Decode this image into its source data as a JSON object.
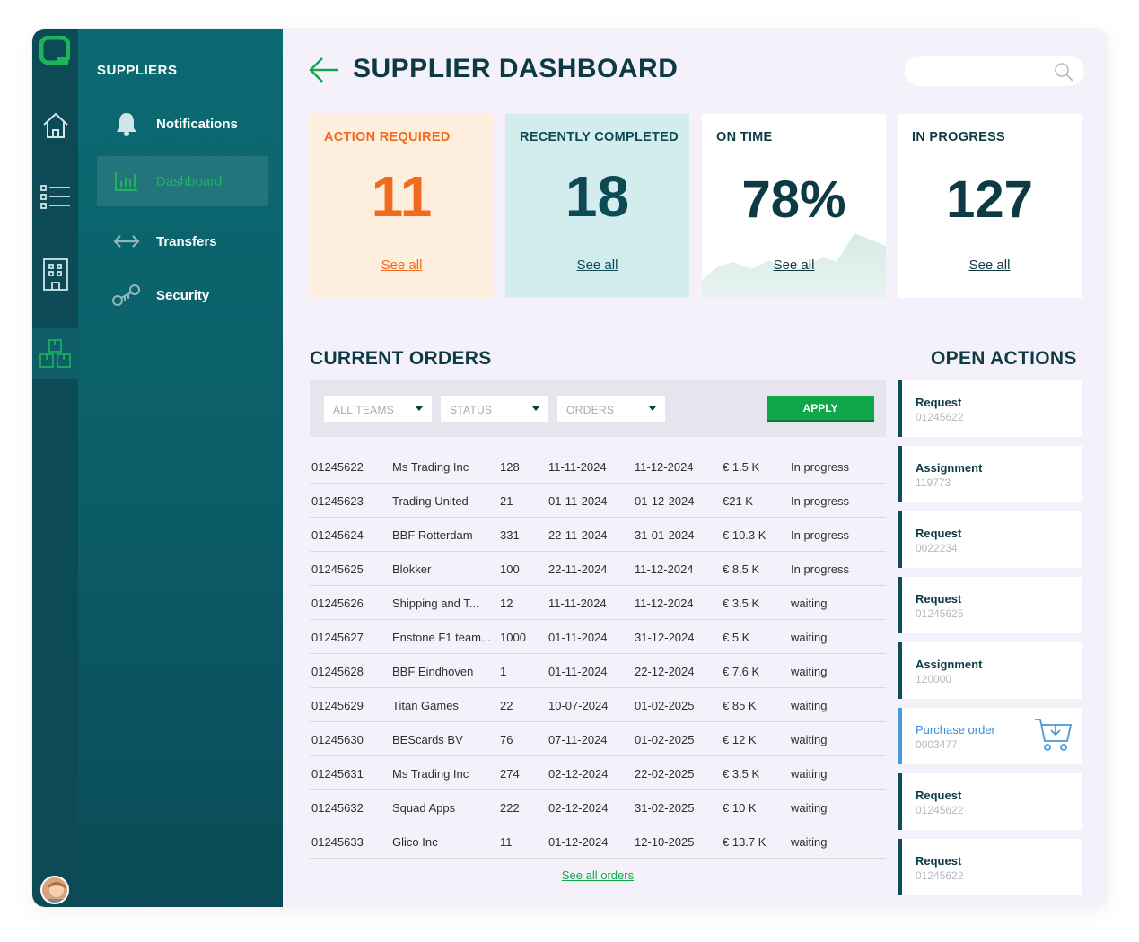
{
  "sidebar": {
    "section_title": "SUPPLIERS",
    "items": [
      {
        "label": "Notifications",
        "icon": "bell-icon"
      },
      {
        "label": "Dashboard",
        "icon": "chart-icon",
        "active": true
      },
      {
        "label": "Transfers",
        "icon": "arrows-icon"
      },
      {
        "label": "Security",
        "icon": "key-icon"
      }
    ]
  },
  "header": {
    "title": "SUPPLIER DASHBOARD"
  },
  "cards": [
    {
      "label": "ACTION REQUIRED",
      "value": "11",
      "link": "See all"
    },
    {
      "label": "RECENTLY COMPLETED",
      "value": "18",
      "link": "See all"
    },
    {
      "label": "ON TIME",
      "value": "78%",
      "link": "See all"
    },
    {
      "label": "IN PROGRESS",
      "value": "127",
      "link": "See all"
    }
  ],
  "orders": {
    "title": "CURRENT ORDERS",
    "filters": [
      "ALL TEAMS",
      "STATUS",
      "ORDERS"
    ],
    "apply_label": "APPLY",
    "rows": [
      [
        "01245622",
        "Ms Trading Inc",
        "128",
        "11-11-2024",
        "11-12-2024",
        "€ 1.5 K",
        "In progress"
      ],
      [
        "01245623",
        "Trading United",
        "21",
        "01-11-2024",
        "01-12-2024",
        "€21 K",
        "In progress"
      ],
      [
        "01245624",
        "BBF Rotterdam",
        "331",
        "22-11-2024",
        "31-01-2024",
        "€ 10.3 K",
        "In progress"
      ],
      [
        "01245625",
        "Blokker",
        "100",
        "22-11-2024",
        "11-12-2024",
        "€ 8.5 K",
        "In progress"
      ],
      [
        "01245626",
        "Shipping and T...",
        "12",
        "11-11-2024",
        "11-12-2024",
        "€ 3.5 K",
        "waiting"
      ],
      [
        "01245627",
        "Enstone F1 team...",
        "1000",
        "01-11-2024",
        "31-12-2024",
        "€ 5 K",
        "waiting"
      ],
      [
        "01245628",
        "BBF Eindhoven",
        "1",
        "01-11-2024",
        "22-12-2024",
        "€ 7.6 K",
        "waiting"
      ],
      [
        "01245629",
        "Titan Games",
        "22",
        "10-07-2024",
        "01-02-2025",
        "€ 85 K",
        "waiting"
      ],
      [
        "01245630",
        "BEScards BV",
        "76",
        "07-11-2024",
        "01-02-2025",
        "€ 12 K",
        "waiting"
      ],
      [
        "01245631",
        "Ms Trading Inc",
        "274",
        "02-12-2024",
        "22-02-2025",
        "€ 3.5 K",
        "waiting"
      ],
      [
        "01245632",
        "Squad Apps",
        "222",
        "02-12-2024",
        "31-02-2025",
        "€ 10 K",
        "waiting"
      ],
      [
        "01245633",
        "Glico Inc",
        "11",
        "01-12-2024",
        "12-10-2025",
        "€ 13.7 K",
        "waiting"
      ]
    ],
    "see_all": "See all orders"
  },
  "open_actions": {
    "title": "OPEN ACTIONS",
    "items": [
      {
        "title": "Request",
        "number": "01245622"
      },
      {
        "title": "Assignment",
        "number": "119773"
      },
      {
        "title": "Request",
        "number": "0022234"
      },
      {
        "title": "Request",
        "number": "01245625"
      },
      {
        "title": "Assignment",
        "number": "120000"
      },
      {
        "title": "Purchase order",
        "number": "0003477",
        "icon": "cart-icon"
      },
      {
        "title": "Request",
        "number": "01245622"
      },
      {
        "title": "Request",
        "number": "01245622"
      }
    ]
  },
  "colors": {
    "accent": "#10a74b",
    "orange": "#f26a1b",
    "dark_teal": "#0e3a44",
    "sidebar": "#0b5e68"
  }
}
